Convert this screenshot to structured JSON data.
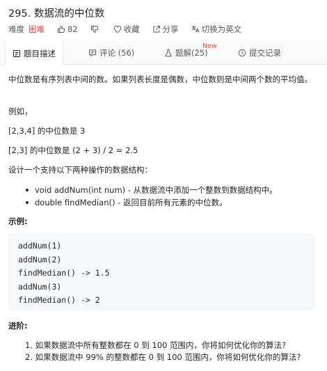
{
  "problem": {
    "title": "295. 数据流的中位数"
  },
  "meta": {
    "difficulty_label": "难度",
    "difficulty": "困难",
    "likes": "82",
    "favorite_label": "收藏",
    "share_label": "分享",
    "switch_lang_label": "切换为英文",
    "colors": {
      "difficulty": "#ef4743",
      "badge_new": "#ef4743"
    }
  },
  "tabs": {
    "description": "题目描述",
    "comments": "评论 (56)",
    "solutions": "题解(25)",
    "solutions_badge": "New",
    "submissions": "提交记录"
  },
  "content": {
    "intro": "中位数是有序列表中间的数。如果列表长度是偶数，中位数则是中间两个数的平均值。",
    "example_label": "例如，",
    "example1": "[2,3,4] 的中位数是 3",
    "example2": "[2,3] 的中位数是 (2 + 3) / 2 = 2.5",
    "design_text": "设计一个支持以下两种操作的数据结构：",
    "bullets": [
      "void addNum(int num) - 从数据流中添加一个整数到数据结构中。",
      "double findMedian() - 返回目前所有元素的中位数。"
    ],
    "sample_heading": "示例:",
    "code_lines": [
      "addNum(1)",
      "addNum(2)",
      "findMedian() -> 1.5",
      "addNum(3)",
      "findMedian() -> 2"
    ],
    "followup_heading": "进阶:",
    "followups": [
      "1. 如果数据流中所有整数都在 0 到 100 范围内，你将如何优化你的算法?",
      "2. 如果数据流中 99% 的整数都在 0 到 100 范围内，你将如何优化你的算法?"
    ]
  }
}
